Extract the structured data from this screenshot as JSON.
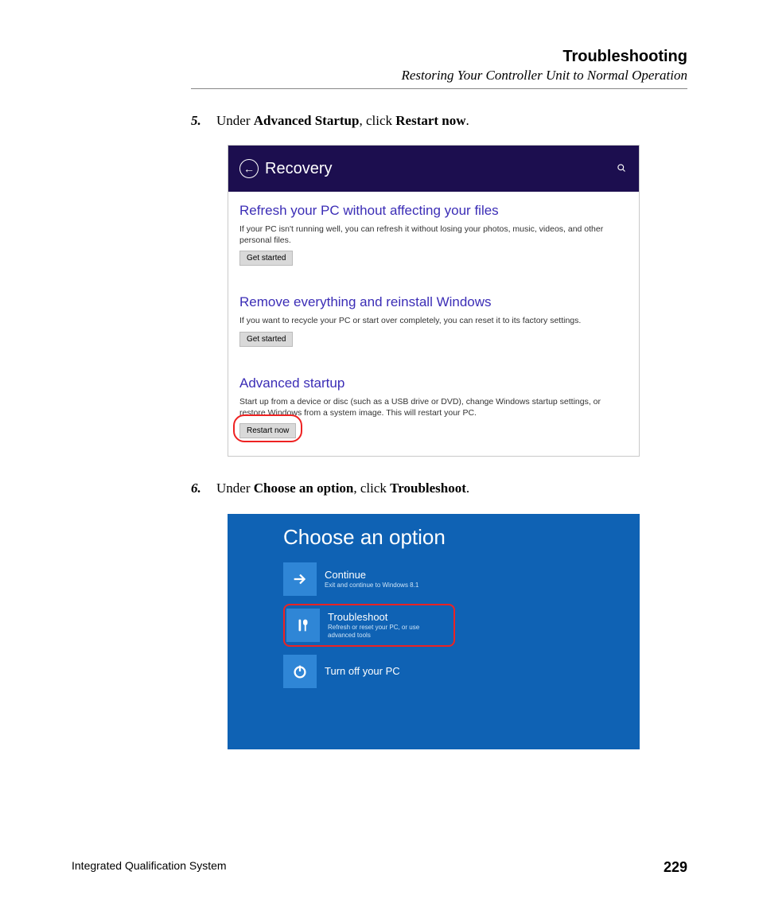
{
  "header": {
    "title": "Troubleshooting",
    "subtitle": "Restoring Your Controller Unit to Normal Operation"
  },
  "steps": {
    "s5": {
      "num": "5.",
      "pre": "Under ",
      "b1": "Advanced Startup",
      "mid": ", click ",
      "b2": "Restart now",
      "post": "."
    },
    "s6": {
      "num": "6.",
      "pre": "Under ",
      "b1": "Choose an option",
      "mid": ", click ",
      "b2": "Troubleshoot",
      "post": "."
    }
  },
  "recovery": {
    "title": "Recovery",
    "search_icon": "search-icon",
    "sections": [
      {
        "title": "Refresh your PC without affecting your files",
        "desc": "If your PC isn't running well, you can refresh it without losing your photos, music, videos, and other personal files.",
        "button": "Get started"
      },
      {
        "title": "Remove everything and reinstall Windows",
        "desc": "If you want to recycle your PC or start over completely, you can reset it to its factory settings.",
        "button": "Get started"
      },
      {
        "title": "Advanced startup",
        "desc": "Start up from a device or disc (such as a USB drive or DVD), change Windows startup settings, or restore Windows from a system image. This will restart your PC.",
        "button": "Restart now"
      }
    ]
  },
  "choose": {
    "title": "Choose an option",
    "tiles": [
      {
        "label": "Continue",
        "desc": "Exit and continue to Windows 8.1"
      },
      {
        "label": "Troubleshoot",
        "desc": "Refresh or reset your PC, or use advanced tools"
      },
      {
        "label": "Turn off your PC",
        "desc": ""
      }
    ]
  },
  "footer": {
    "left": "Integrated Qualification System",
    "right": "229"
  }
}
